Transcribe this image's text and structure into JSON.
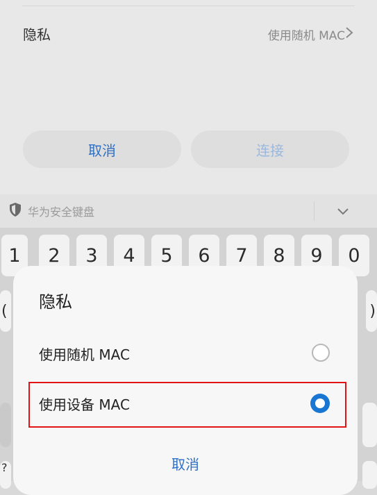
{
  "settings": {
    "privacy_label": "隐私",
    "privacy_value": "使用随机 MAC",
    "cancel_button": "取消",
    "connect_button": "连接"
  },
  "keyboard": {
    "title": "华为安全键盘",
    "number_keys": [
      "1",
      "2",
      "3",
      "4",
      "5",
      "6",
      "7",
      "8",
      "9",
      "0"
    ],
    "left_partial": "(",
    "right_partial": ")",
    "bottom_partial": "?"
  },
  "dialog": {
    "title": "隐私",
    "options": [
      {
        "label": "使用随机 MAC",
        "selected": false
      },
      {
        "label": "使用设备 MAC",
        "selected": true
      }
    ],
    "cancel_label": "取消",
    "accent_color": "#1976d2",
    "highlight_color": "#e01414"
  }
}
